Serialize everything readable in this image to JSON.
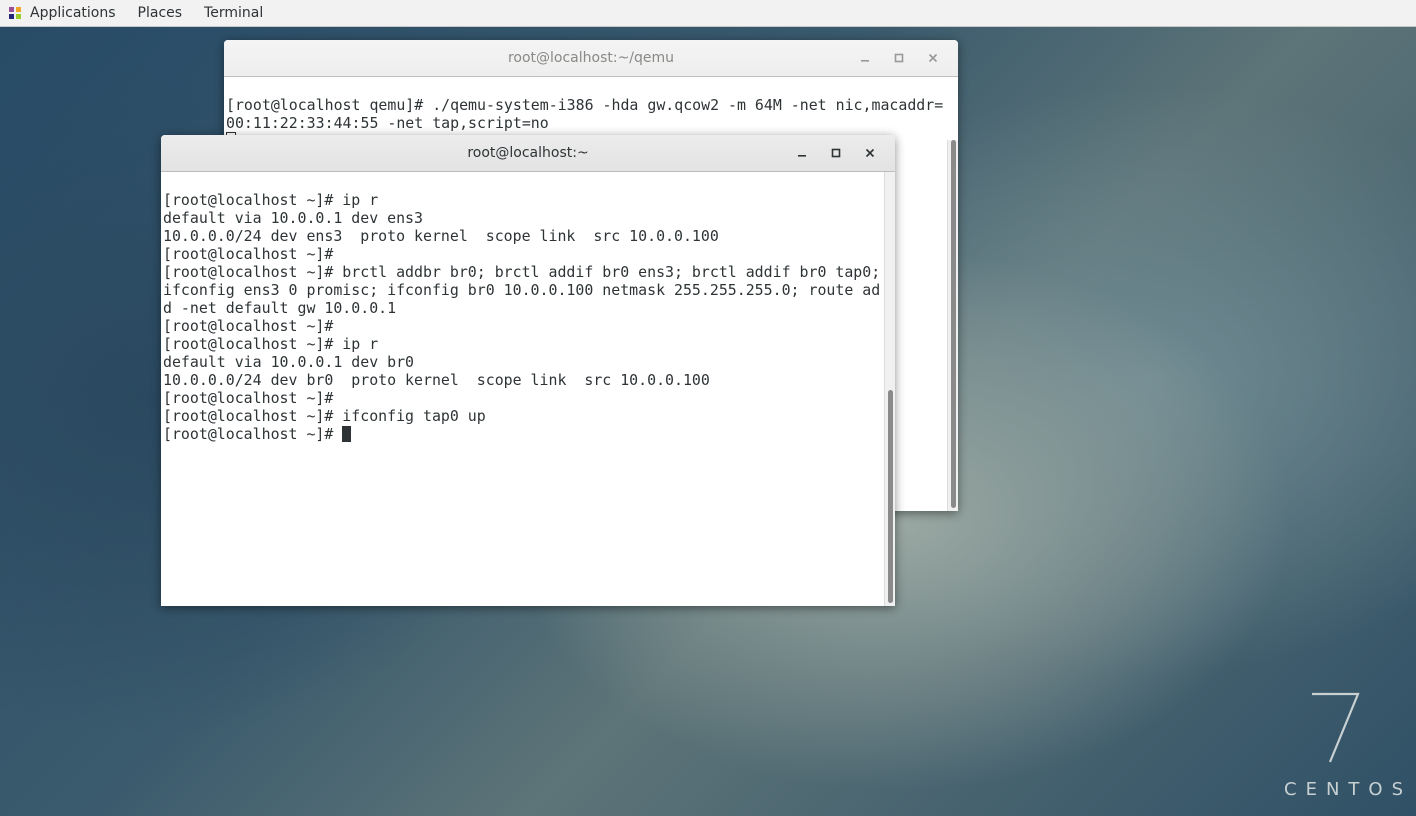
{
  "topbar": {
    "menus": [
      "Applications",
      "Places",
      "Terminal"
    ]
  },
  "windows": {
    "back": {
      "title": "root@localhost:~/qemu",
      "lines": [
        "[root@localhost qemu]# ./qemu-system-i386 -hda gw.qcow2 -m 64M -net nic,macaddr=",
        "00:11:22:33:44:55 -net tap,script=no"
      ]
    },
    "front": {
      "title": "root@localhost:~",
      "lines": [
        "[root@localhost ~]# ip r",
        "default via 10.0.0.1 dev ens3",
        "10.0.0.0/24 dev ens3  proto kernel  scope link  src 10.0.0.100",
        "[root@localhost ~]#",
        "[root@localhost ~]# brctl addbr br0; brctl addif br0 ens3; brctl addif br0 tap0;",
        "ifconfig ens3 0 promisc; ifconfig br0 10.0.0.100 netmask 255.255.255.0; route ad",
        "d -net default gw 10.0.0.1",
        "[root@localhost ~]#",
        "[root@localhost ~]# ip r",
        "default via 10.0.0.1 dev br0",
        "10.0.0.0/24 dev br0  proto kernel  scope link  src 10.0.0.100",
        "[root@localhost ~]#",
        "[root@localhost ~]# ifconfig tap0 up",
        "[root@localhost ~]# "
      ]
    }
  },
  "icons": {
    "minimize": "minimize-icon",
    "maximize": "maximize-icon",
    "close": "close-icon"
  },
  "branding": {
    "version": "7",
    "name": "CENTOS"
  },
  "colors": {
    "terminal_text": "#2e3436",
    "topbar_bg": "#f2f2f2"
  }
}
